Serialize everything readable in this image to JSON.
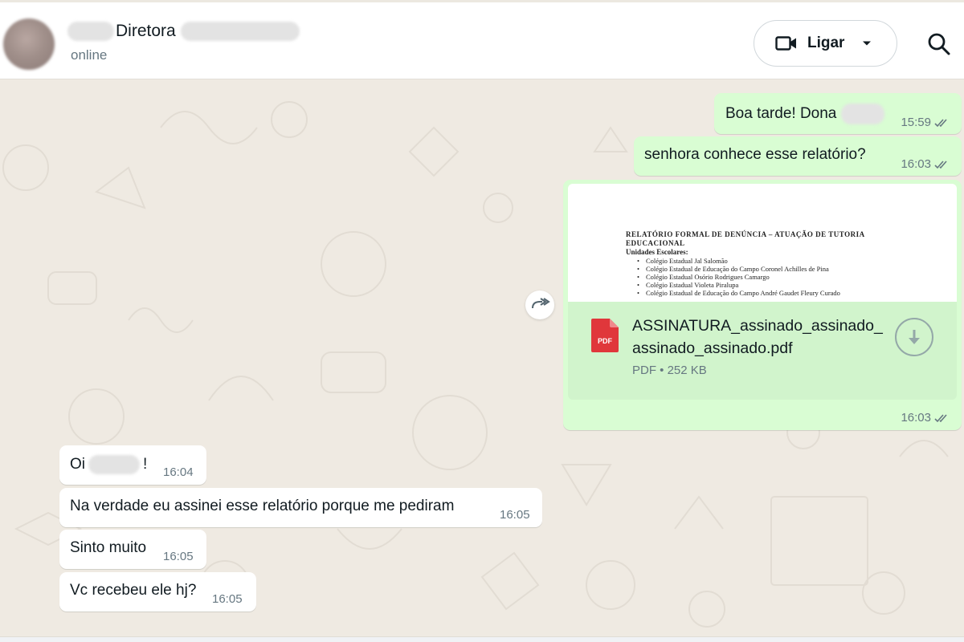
{
  "header": {
    "contact_name": "Diretora",
    "status": "online",
    "call_label": "Ligar",
    "icons": [
      "video-icon",
      "chevron-down-icon",
      "search-icon"
    ]
  },
  "messages": {
    "m1": {
      "text": "Boa tarde! Dona",
      "time": "15:59",
      "direction": "outgoing",
      "status": "read"
    },
    "m2": {
      "text": "senhora conhece esse relatório?",
      "time": "16:03",
      "direction": "outgoing",
      "status": "read"
    },
    "m3": {
      "direction": "outgoing",
      "status": "read",
      "time": "16:03",
      "preview": {
        "title": "RELATÓRIO FORMAL DE DENÚNCIA – ATUAÇÃO DE TUTORIA EDUCACIONAL",
        "subtitle": "Unidades Escolares:",
        "items": [
          "Colégio Estadual Jal Salomão",
          "Colégio Estadual de Educação do Campo Coronel Achilles de Pina",
          "Colégio Estadual Osório Rodrigues Camargo",
          "Colégio Estadual Violeta Piralupa",
          "Colégio Estadual de Educação do Campo André Gaudet Fleury Curado"
        ]
      },
      "file": {
        "icon_label": "PDF",
        "name": "ASSINATURA_assinado_assinado_assinado_assinado.pdf",
        "meta": "PDF • 252 KB"
      }
    },
    "m4": {
      "text_before": "Oi",
      "text_after": "!",
      "time": "16:04",
      "direction": "incoming"
    },
    "m5": {
      "text": "Na verdade eu assinei esse relatório porque me pediram",
      "time": "16:05",
      "direction": "incoming"
    },
    "m6": {
      "text": "Sinto muito",
      "time": "16:05",
      "direction": "incoming"
    },
    "m7": {
      "text": "Vc recebeu ele hj?",
      "time": "16:05",
      "direction": "incoming"
    }
  },
  "colors": {
    "outgoing_bubble": "#d9fdd3",
    "incoming_bubble": "#ffffff",
    "chat_background": "#efeae2",
    "read_tick": "#667781",
    "pdf_red": "#e0373b"
  }
}
